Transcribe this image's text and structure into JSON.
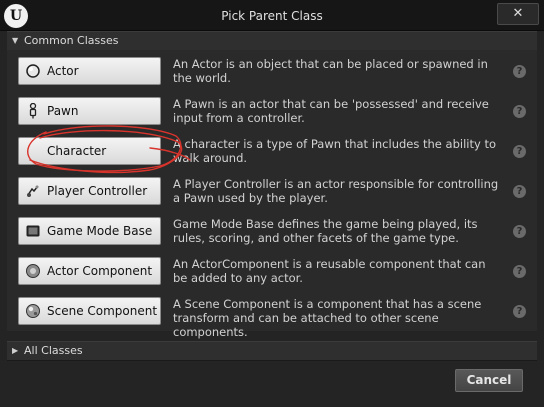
{
  "window": {
    "title": "Pick Parent Class",
    "close_glyph": "✕",
    "logo_glyph": "U"
  },
  "common_classes": {
    "header": "Common Classes",
    "items": [
      {
        "label": "Actor",
        "icon": "actor-sphere-icon",
        "description": "An Actor is an object that can be placed or spawned in the world."
      },
      {
        "label": "Pawn",
        "icon": "pawn-figure-icon",
        "description": "A Pawn is an actor that can be 'possessed' and receive input from a controller."
      },
      {
        "label": "Character",
        "icon": "character-icon",
        "description": "A character is a type of Pawn that includes the ability to walk around."
      },
      {
        "label": "Player Controller",
        "icon": "player-controller-icon",
        "description": "A Player Controller is an actor responsible for controlling a Pawn used by the player."
      },
      {
        "label": "Game Mode Base",
        "icon": "game-mode-icon",
        "description": "Game Mode Base defines the game being played, its rules, scoring, and other facets of the game type."
      },
      {
        "label": "Actor Component",
        "icon": "actor-component-icon",
        "description": "An ActorComponent is a reusable component that can be added to any actor."
      },
      {
        "label": "Scene Component",
        "icon": "scene-component-icon",
        "description": "A Scene Component is a component that has a scene transform and can be attached to other scene components."
      }
    ]
  },
  "all_classes": {
    "header": "All Classes"
  },
  "help_glyph": "?",
  "footer": {
    "cancel_label": "Cancel"
  },
  "annotation": {
    "color": "#d8342c"
  }
}
